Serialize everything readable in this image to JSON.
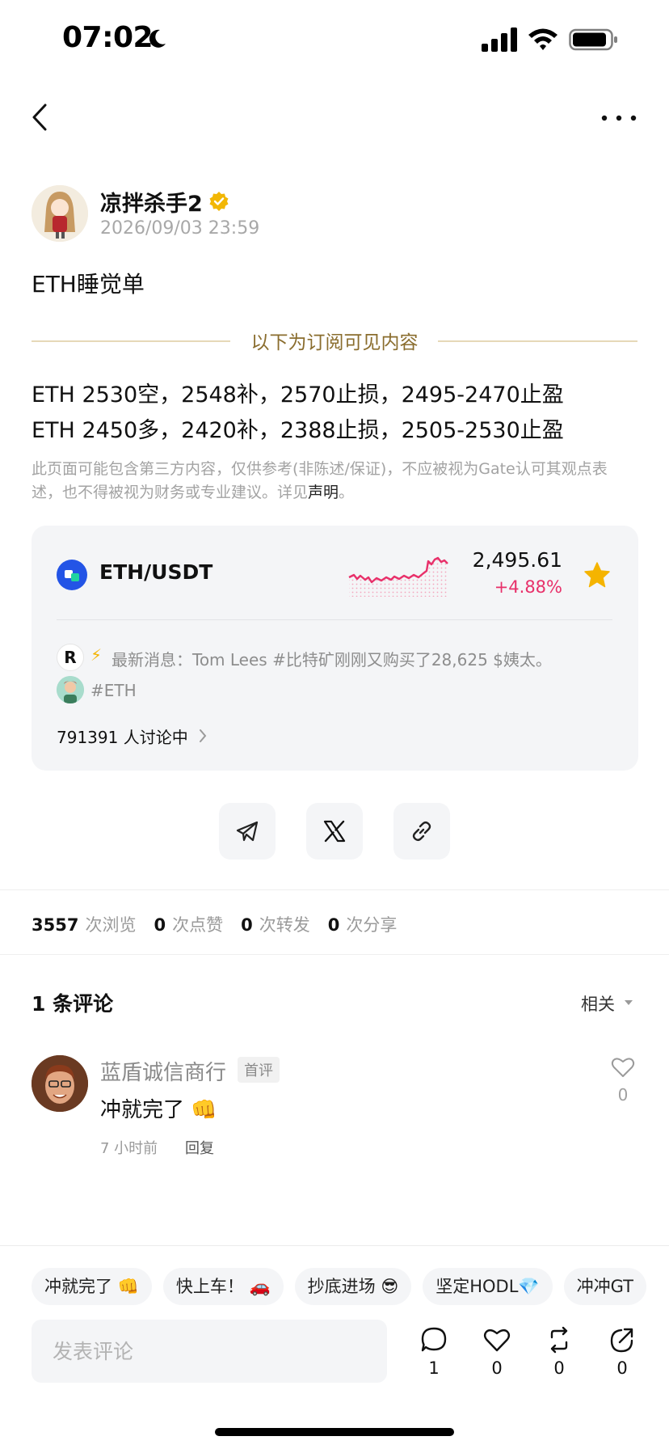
{
  "status_bar": {
    "time": "07:02"
  },
  "author": {
    "name": "凉拌杀手2",
    "date": "2026/09/03 23:59"
  },
  "post": {
    "title": "ETH睡觉单",
    "subscription_label": "以下为订阅可见内容",
    "lines": [
      "ETH 2530空，2548补，2570止损，2495-2470止盈",
      "ETH 2450多，2420补，2388止损，2505-2530止盈"
    ],
    "disclaimer": "此页面可能包含第三方内容，仅供参考(非陈述/保证)，不应被视为Gate认可其观点表述，也不得被视为财务或专业建议。详见",
    "disclaimer_link": "声明",
    "disclaimer_end": "。"
  },
  "market": {
    "pair": "ETH/USDT",
    "price": "2,495.61",
    "change": "+4.88%",
    "favorited": true,
    "news_icon_letter": "R",
    "news": "最新消息：Tom Lees #比特矿刚刚又购买了28,625 $姨太。",
    "tag": "#ETH",
    "discussing": "791391 人讨论中"
  },
  "stats": {
    "views": "3557",
    "views_label": "次浏览",
    "likes": "0",
    "likes_label": "次点赞",
    "reposts": "0",
    "reposts_label": "次转发",
    "shares": "0",
    "shares_label": "次分享"
  },
  "comments": {
    "title": "1 条评论",
    "sort": "相关",
    "items": [
      {
        "name": "蓝盾诚信商行",
        "badge": "首评",
        "text": "冲就完了 👊",
        "time": "7 小时前",
        "reply": "回复",
        "likes": "0"
      }
    ]
  },
  "quick_replies": [
    "冲就完了 👊",
    "快上车！ 🚗",
    "抄底进场 😎",
    "坚定HODL💎",
    "冲冲GT"
  ],
  "composer": {
    "placeholder": "发表评论"
  },
  "actions": {
    "comments": "1",
    "likes": "0",
    "reposts": "0",
    "shares": "0"
  },
  "colors": {
    "accent_gold": "#8a6d2e",
    "up_red": "#e8306a",
    "star": "#f5b400",
    "pair_icon": "#2354e6"
  }
}
